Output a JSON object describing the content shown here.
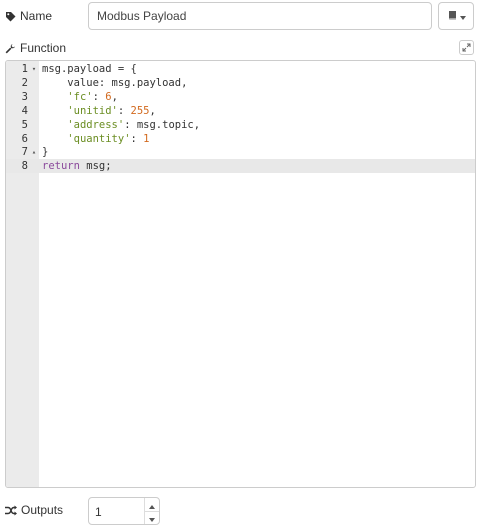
{
  "name_field": {
    "label": "Name",
    "value": "Modbus Payload",
    "icon": "tag-icon"
  },
  "library_button": {
    "icon": "book-icon"
  },
  "function_field": {
    "label": "Function",
    "icon": "wrench-icon"
  },
  "editor": {
    "lines": [
      {
        "no": "1",
        "fold": "▾",
        "tokens": [
          {
            "t": "msg.payload = {",
            "c": ""
          }
        ]
      },
      {
        "no": "2",
        "fold": "",
        "tokens": [
          {
            "t": "    value: msg.payload,",
            "c": ""
          }
        ]
      },
      {
        "no": "3",
        "fold": "",
        "tokens": [
          {
            "t": "    ",
            "c": ""
          },
          {
            "t": "'fc'",
            "c": "str"
          },
          {
            "t": ": ",
            "c": ""
          },
          {
            "t": "6",
            "c": "num"
          },
          {
            "t": ",",
            "c": ""
          }
        ]
      },
      {
        "no": "4",
        "fold": "",
        "tokens": [
          {
            "t": "    ",
            "c": ""
          },
          {
            "t": "'unitid'",
            "c": "str"
          },
          {
            "t": ": ",
            "c": ""
          },
          {
            "t": "255",
            "c": "num"
          },
          {
            "t": ",",
            "c": ""
          }
        ]
      },
      {
        "no": "5",
        "fold": "",
        "tokens": [
          {
            "t": "    ",
            "c": ""
          },
          {
            "t": "'address'",
            "c": "str"
          },
          {
            "t": ": msg.topic,",
            "c": ""
          }
        ]
      },
      {
        "no": "6",
        "fold": "",
        "tokens": [
          {
            "t": "    ",
            "c": ""
          },
          {
            "t": "'quantity'",
            "c": "str"
          },
          {
            "t": ": ",
            "c": ""
          },
          {
            "t": "1",
            "c": "num"
          }
        ]
      },
      {
        "no": "7",
        "fold": "▴",
        "tokens": [
          {
            "t": "}",
            "c": ""
          }
        ]
      },
      {
        "no": "8",
        "fold": "",
        "active": true,
        "tokens": [
          {
            "t": "return",
            "c": "kw"
          },
          {
            "t": " msg;",
            "c": ""
          }
        ]
      }
    ]
  },
  "outputs_field": {
    "label": "Outputs",
    "value": "1",
    "icon": "random-icon"
  },
  "colors": {
    "string": "#6b8e23",
    "number": "#d2691e",
    "keyword": "#8b4a9c",
    "gutter": "#ebebeb",
    "border": "#cccccc"
  }
}
